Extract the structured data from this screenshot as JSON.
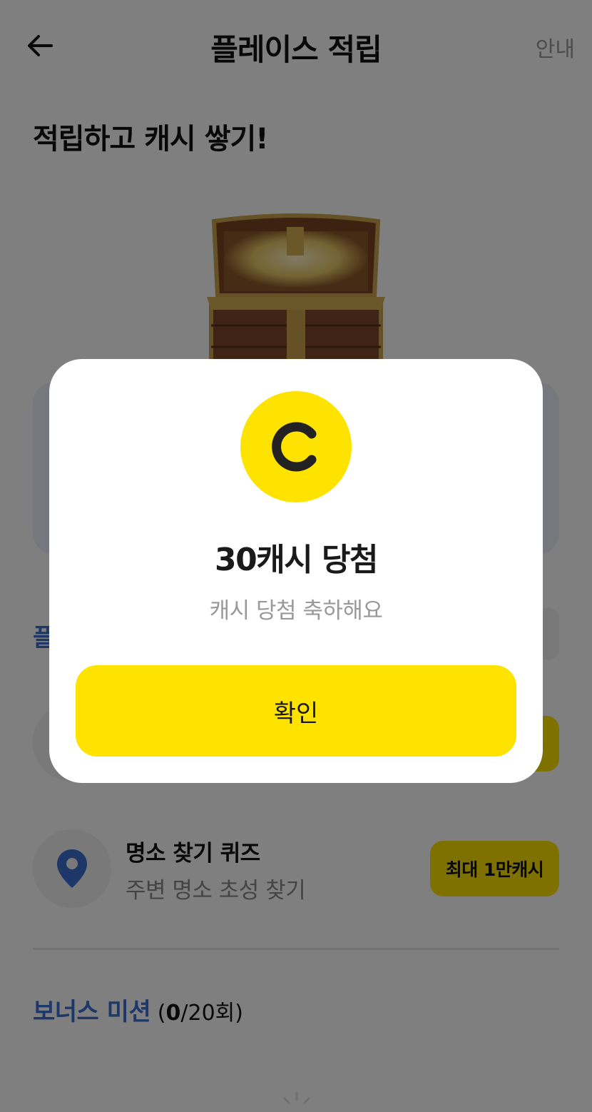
{
  "header": {
    "title": "플레이스 적립",
    "guide_label": "안내",
    "back_icon": "arrow-left-icon"
  },
  "hero": {
    "title": "적립하고 캐시 쌓기!",
    "image": "treasure-chest"
  },
  "section_partial": {
    "visible_text": "플"
  },
  "quiz": {
    "icon": "location-pin-icon",
    "title": "명소 찾기 퀴즈",
    "subtitle": "주변 명소 초성 찾기",
    "badge": "최대 1만캐시"
  },
  "bonus": {
    "title": "보너스 미션",
    "open": " (",
    "count": "0",
    "total": "/20회)"
  },
  "modal": {
    "coin_letter": "C",
    "title": "30캐시 당첨",
    "subtitle": "캐시 당첨 축하해요",
    "confirm_label": "확인"
  },
  "colors": {
    "accent_yellow": "#ffe300",
    "link_blue": "#3b6fd0",
    "overlay": "rgba(0,0,0,0.5)"
  }
}
